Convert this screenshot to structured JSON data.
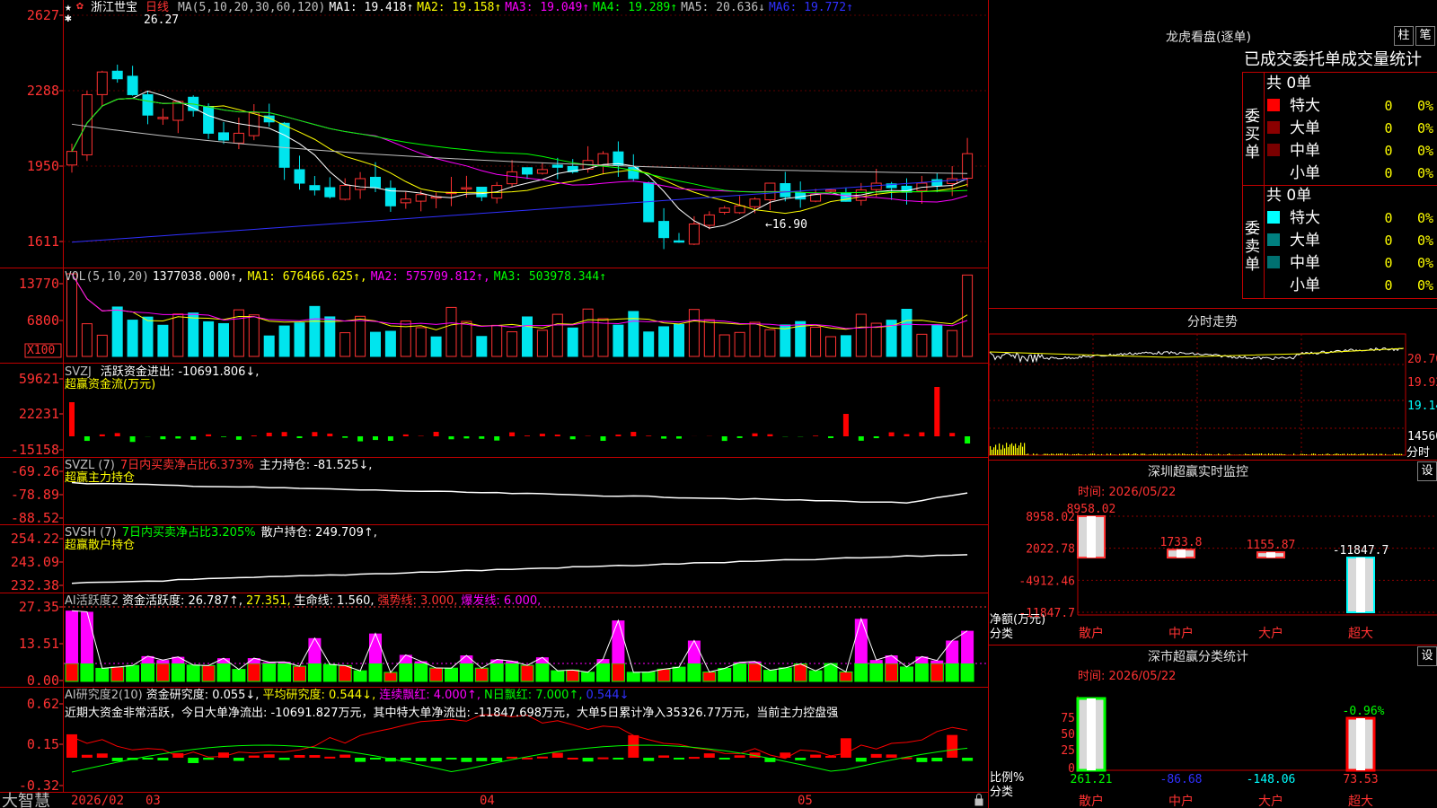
{
  "stock_name": "浙江世宝",
  "period": "日线",
  "brand": "大智慧",
  "colors": {
    "up": "#ff3232",
    "down": "#00e5ee",
    "ma1": "#ffffff",
    "ma2": "#ffff00",
    "ma3": "#ff00ff",
    "ma4": "#00ff00",
    "ma5": "#c0c0c0",
    "ma6": "#3030ff",
    "grid": "#8b0000",
    "border": "#c00000"
  },
  "main_chart": {
    "y_labels": [
      "2627",
      "2288",
      "1950",
      "1611"
    ],
    "ma_legend": [
      {
        "text": "MA(5,10,20,30,60,120)",
        "color": "#c0c0c0"
      },
      {
        "text": "MA1: 19.418↑",
        "color": "#ffffff"
      },
      {
        "text": "MA2: 19.158↑",
        "color": "#ffff00"
      },
      {
        "text": "MA3: 19.049↑",
        "color": "#ff00ff"
      },
      {
        "text": "MA4: 19.289↑",
        "color": "#00ff00"
      },
      {
        "text": "MA5: 20.636↓",
        "color": "#c0c0c0"
      },
      {
        "text": "MA6: 19.772↑",
        "color": "#3030ff"
      }
    ],
    "high_mark": "26.27",
    "low_mark": "←16.90"
  },
  "vol_chart": {
    "y_labels": [
      "13770",
      "6800"
    ],
    "unit": "X100",
    "legend": [
      {
        "text": "VOL(5,10,20)",
        "color": "#c0c0c0"
      },
      {
        "text": "1377038.000↑,",
        "color": "#ffffff"
      },
      {
        "text": "MA1: 676466.625↑,",
        "color": "#ffff00"
      },
      {
        "text": "MA2: 575709.812↑,",
        "color": "#ff00ff"
      },
      {
        "text": "MA3: 503978.344↑",
        "color": "#00ff00"
      }
    ]
  },
  "svzj": {
    "y_labels": [
      "59621",
      "22231",
      "-15158"
    ],
    "legend": [
      {
        "text": "SVZJ",
        "color": "#c0c0c0"
      },
      {
        "text": "活跃资金进出: -10691.806↓,",
        "color": "#ffffff"
      }
    ],
    "subtitle": "超赢资金流(万元)"
  },
  "svzl": {
    "y_labels": [
      "-69.26",
      "-78.89",
      "-88.52"
    ],
    "legend": [
      {
        "text": "SVZL (7)",
        "color": "#c0c0c0"
      },
      {
        "text": "7日内买卖净占比6.373%",
        "color": "#ff3232"
      },
      {
        "text": "主力持仓: -81.525↓,",
        "color": "#ffffff"
      }
    ],
    "subtitle": "超赢主力持仓"
  },
  "svsh": {
    "y_labels": [
      "254.22",
      "243.09",
      "232.38"
    ],
    "legend": [
      {
        "text": "SVSH (7)",
        "color": "#c0c0c0"
      },
      {
        "text": "7日内买卖净占比3.205%",
        "color": "#00ff00"
      },
      {
        "text": "散户持仓: 249.709↑,",
        "color": "#ffffff"
      }
    ],
    "subtitle": "超赢散户持仓"
  },
  "ai_activity": {
    "y_labels": [
      "27.35",
      "13.51",
      "0.00"
    ],
    "legend": [
      {
        "text": "AI活跃度2",
        "color": "#c0c0c0"
      },
      {
        "text": "资金活跃度: 26.787↑,",
        "color": "#ffffff"
      },
      {
        "text": "27.351,",
        "color": "#ffff00"
      },
      {
        "text": "生命线: 1.560,",
        "color": "#ffffff"
      },
      {
        "text": "强势线: 3.000,",
        "color": "#ff3232"
      },
      {
        "text": "爆发线: 6.000,",
        "color": "#ff00ff"
      }
    ]
  },
  "ai_research": {
    "y_labels": [
      "0.62",
      "0.15",
      "-0.32"
    ],
    "legend": [
      {
        "text": "AI研究度2(10)",
        "color": "#c0c0c0"
      },
      {
        "text": "资金研究度: 0.055↓,",
        "color": "#ffffff"
      },
      {
        "text": "平均研究度: 0.544↓,",
        "color": "#ffff00"
      },
      {
        "text": "连续飘红: 4.000↑,",
        "color": "#ff00ff"
      },
      {
        "text": "N日飘红: 7.000↑,",
        "color": "#00ff00"
      },
      {
        "text": "0.544↓",
        "color": "#3030ff"
      }
    ],
    "comment": "近期大资金非常活跃，今日大单净流出: -10691.827万元，其中特大单净流出: -11847.698万元，大单5日累计净入35326.77万元，当前主力控盘强"
  },
  "date_axis": [
    "2026/02",
    "03",
    "04",
    "05"
  ],
  "dragon_panel": {
    "title": "龙虎看盘(逐单)",
    "btn_column": "柱",
    "btn_tick": "笔",
    "stats_title": "已成交委托单成交量统计",
    "buy_side_label": "委买单",
    "sell_side_label": "委卖单",
    "buy_total": "共 0单",
    "sell_total": "共 0单",
    "buy_rows": [
      {
        "name": "特大",
        "count": "0",
        "pct": "0%",
        "color": "#ff0000"
      },
      {
        "name": "大单",
        "count": "0",
        "pct": "0%",
        "color": "#8b0000"
      },
      {
        "name": "中单",
        "count": "0",
        "pct": "0%",
        "color": "#7a0000"
      },
      {
        "name": "小单",
        "count": "0",
        "pct": "0%",
        "color": ""
      }
    ],
    "sell_rows": [
      {
        "name": "特大",
        "count": "0",
        "pct": "0%",
        "color": "#00ffff"
      },
      {
        "name": "大单",
        "count": "0",
        "pct": "0%",
        "color": "#008080"
      },
      {
        "name": "中单",
        "count": "0",
        "pct": "0%",
        "color": "#007070"
      },
      {
        "name": "小单",
        "count": "0",
        "pct": "0%",
        "color": ""
      }
    ]
  },
  "intraday": {
    "title": "分时走势",
    "y_labels": [
      "20.70",
      "19.92",
      "19.14",
      "14560"
    ],
    "unit": "分时"
  },
  "sz_monitor": {
    "title": "深圳超赢实时监控",
    "settings_label": "设",
    "time": "时间: 2026/05/22",
    "y_labels": [
      "8958.02",
      "2022.78",
      "-4912.46",
      "-11847.7"
    ],
    "y_unit": "净额(万元)",
    "x_unit": "分类",
    "categories": [
      "散户",
      "中户",
      "大户",
      "超大"
    ],
    "values": [
      8958.02,
      1733.8,
      1155.87,
      -11847.7
    ],
    "value_labels": [
      "8958.02",
      "1733.8",
      "1155.87",
      "-11847.7"
    ]
  },
  "sz_classify": {
    "title": "深市超赢分类统计",
    "settings_label": "设",
    "time": "时间: 2026/05/22",
    "y_labels": [
      "75",
      "50",
      "25",
      "0"
    ],
    "y_unit": "比例%",
    "x_unit": "分类",
    "categories": [
      "散户",
      "中户",
      "大户",
      "超大"
    ],
    "bottom_values": [
      "261.21",
      "-86.68",
      "-148.06",
      "73.53"
    ],
    "top_label": "-0.96%"
  },
  "chart_data": {
    "type": "bar",
    "title": "深圳超赢实时监控",
    "categories": [
      "散户",
      "中户",
      "大户",
      "超大"
    ],
    "values": [
      8958.02,
      1733.8,
      1155.87,
      -11847.7
    ],
    "ylabel": "净额(万元)",
    "xlabel": "分类",
    "ylim": [
      -11847.7,
      8958.02
    ]
  }
}
